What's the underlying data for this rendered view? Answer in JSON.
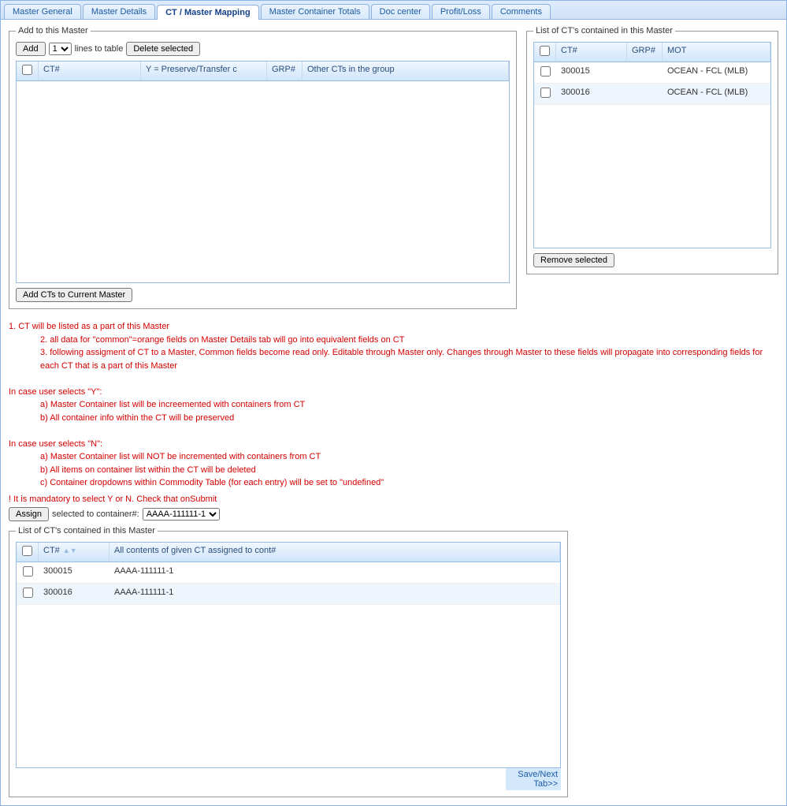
{
  "tabs": [
    "Master General",
    "Master Details",
    "CT / Master Mapping",
    "Master Container Totals",
    "Doc center",
    "Profit/Loss",
    "Comments"
  ],
  "activeTab": "CT / Master Mapping",
  "addPanel": {
    "legend": "Add to this Master",
    "addBtn": "Add",
    "linesSelect": "1",
    "linesLabel": "lines to table",
    "deleteBtn": "Delete selected",
    "columns": {
      "ct": "CT#",
      "preserve": "Y = Preserve/Transfer c",
      "grp": "GRP#",
      "other": "Other CTs in the group"
    },
    "addCtsBtn": "Add CTs to Current Master"
  },
  "listPanel": {
    "legend": "List of CT's contained in this Master",
    "columns": {
      "ct": "CT#",
      "grp": "GRP#",
      "mot": "MOT"
    },
    "rows": [
      {
        "ct": "300015",
        "grp": "",
        "mot": "OCEAN - FCL (MLB)"
      },
      {
        "ct": "300016",
        "grp": "",
        "mot": "OCEAN - FCL (MLB)"
      }
    ],
    "removeBtn": "Remove selected"
  },
  "notes": {
    "l1": "1. CT will be listed as a part of this Master",
    "l2": "2. all data for \"common\"=orange fields on Master Details tab will go into equivalent fields on CT",
    "l3": "3. following assigment of CT to a Master, Common fields become read only. Editable through Master only. Changes through Master to these fields will propagate into corresponding fields for each CT that is a part of this Master",
    "y_h": "In case user selects \"Y\":",
    "y_a": "a) Master Container list will be increemented with containers from CT",
    "y_b": "b) All container info within the CT will be preserved",
    "n_h": "In case user selects \"N\":",
    "n_a": "a) Master Container list will NOT be incremented with containers from CT",
    "n_b": "b) All items on container list within the CT will be deleted",
    "n_c": "c) Container dropdowns within Commodity Table (for each entry) will be set to \"undefined\"",
    "mand": "! It is mandatory to select Y or N. Check that onSubmit"
  },
  "assign": {
    "btn": "Assign",
    "label": "selected to container#:",
    "value": "AAAA-111111-1"
  },
  "bottomPanel": {
    "legend": "List of CT's contained in this Master",
    "columns": {
      "ct": "CT#",
      "assigned": "All contents of given CT assigned to cont#"
    },
    "rows": [
      {
        "ct": "300015",
        "assigned": "AAAA-111111-1"
      },
      {
        "ct": "300016",
        "assigned": "AAAA-111111-1"
      }
    ]
  },
  "saveLink": "Save/Next Tab>>"
}
